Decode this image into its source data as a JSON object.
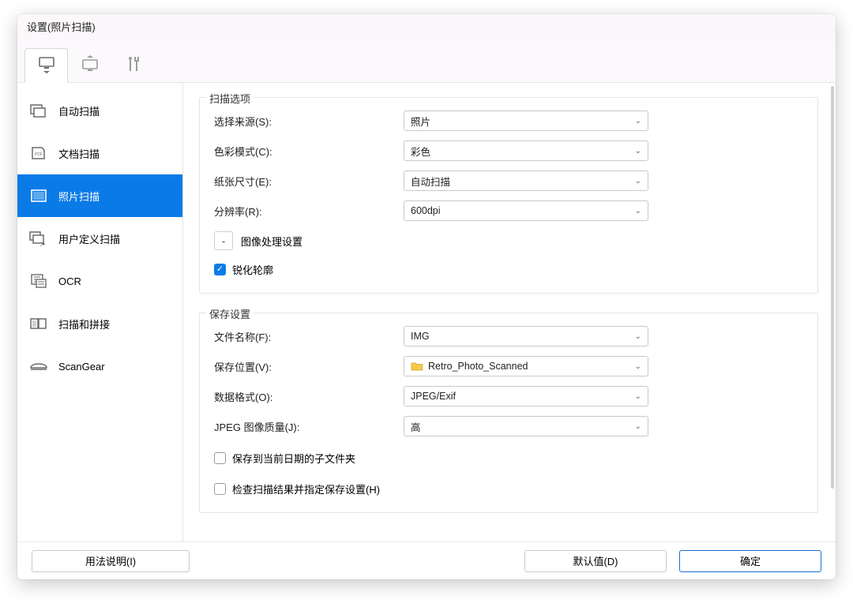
{
  "window": {
    "title": "设置(照片扫描)"
  },
  "tabs": [
    {
      "name": "pc-tab"
    },
    {
      "name": "network-tab"
    },
    {
      "name": "tools-tab"
    }
  ],
  "sidebar": {
    "items": [
      {
        "label": "自动扫描",
        "icon": "auto-scan-icon"
      },
      {
        "label": "文档扫描",
        "icon": "doc-scan-icon"
      },
      {
        "label": "照片扫描",
        "icon": "photo-scan-icon",
        "active": true
      },
      {
        "label": "用户定义扫描",
        "icon": "custom-scan-icon"
      },
      {
        "label": "OCR",
        "icon": "ocr-icon"
      },
      {
        "label": "扫描和拼接",
        "icon": "stitch-icon"
      },
      {
        "label": "ScanGear",
        "icon": "scangear-icon"
      }
    ]
  },
  "scanOptions": {
    "groupTitle": "扫描选项",
    "source": {
      "label": "选择来源(S):",
      "value": "照片"
    },
    "colorMode": {
      "label": "色彩模式(C):",
      "value": "彩色"
    },
    "paperSize": {
      "label": "纸张尺寸(E):",
      "value": "自动扫描"
    },
    "resolution": {
      "label": "分辨率(R):",
      "value": "600dpi"
    },
    "imageProcessing": {
      "toggle": "-",
      "label": "图像处理设置"
    },
    "sharpen": {
      "label": "锐化轮廓",
      "checked": true
    }
  },
  "saveSettings": {
    "groupTitle": "保存设置",
    "fileName": {
      "label": "文件名称(F):",
      "value": "IMG"
    },
    "saveTo": {
      "label": "保存位置(V):",
      "value": "Retro_Photo_Scanned"
    },
    "format": {
      "label": "数据格式(O):",
      "value": "JPEG/Exif"
    },
    "jpegQual": {
      "label": "JPEG 图像质量(J):",
      "value": "高"
    },
    "subfolder": {
      "label": "保存到当前日期的子文件夹",
      "checked": false
    },
    "checkResult": {
      "label": "检查扫描结果并指定保存设置(H)",
      "checked": false
    }
  },
  "footer": {
    "help": "用法说明(I)",
    "defaults": "默认值(D)",
    "ok": "确定"
  }
}
